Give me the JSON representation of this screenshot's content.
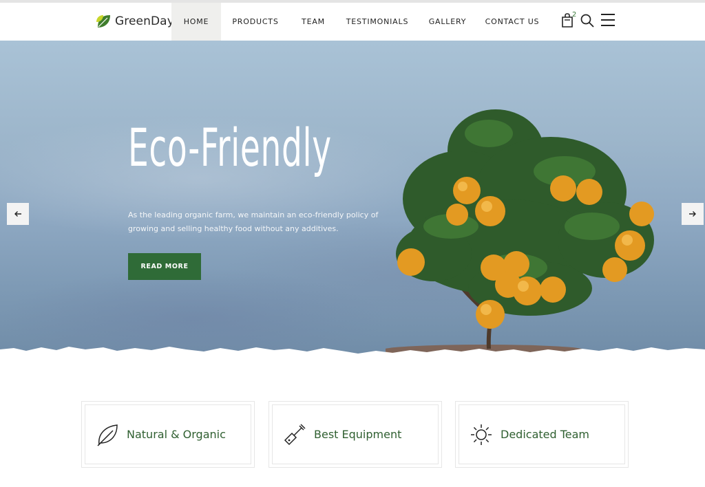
{
  "brand": {
    "name": "GreenDay",
    "accent": "#2f6b37"
  },
  "nav": {
    "items": [
      {
        "label": "HOME",
        "active": true
      },
      {
        "label": "PRODUCTS"
      },
      {
        "label": "TEAM"
      },
      {
        "label": "TESTIMONIALS"
      },
      {
        "label": "GALLERY"
      },
      {
        "label": "CONTACT US"
      }
    ]
  },
  "header_actions": {
    "cart_icon": "shopping-bag-icon",
    "cart_count": "2",
    "search_icon": "search-icon",
    "menu_icon": "hamburger-menu-icon"
  },
  "hero": {
    "title": "Eco-Friendly",
    "line1": "As the leading organic farm, we maintain an eco-friendly policy of",
    "line2": "growing and selling healthy food without any additives.",
    "button": "READ MORE",
    "prev_icon": "arrow-left-icon",
    "next_icon": "arrow-right-icon",
    "image": "potted-orange-tree"
  },
  "features": [
    {
      "label": "Natural & Organic",
      "icon": "leaf-icon"
    },
    {
      "label": "Best Equipment",
      "icon": "shovel-icon"
    },
    {
      "label": "Dedicated Team",
      "icon": "sun-icon"
    }
  ]
}
